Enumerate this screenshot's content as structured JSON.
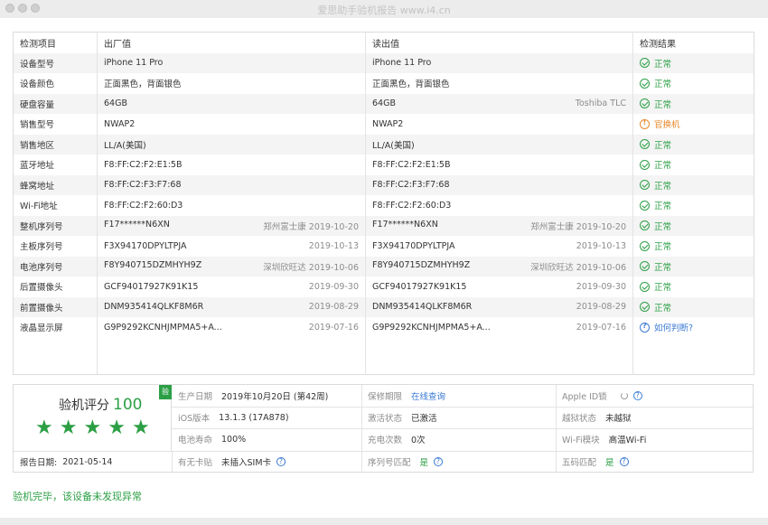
{
  "window": {
    "title": "爱思助手验机报告 www.i4.cn"
  },
  "table": {
    "headers": [
      "检测项目",
      "出厂值",
      "读出值",
      "检测结果"
    ],
    "rows": [
      {
        "item": "设备型号",
        "factory": "iPhone 11 Pro",
        "factory_meta": "",
        "read": "iPhone 11 Pro",
        "read_meta": "",
        "result": "正常",
        "status": "ok"
      },
      {
        "item": "设备颜色",
        "factory": "正面黑色，背面银色",
        "factory_meta": "",
        "read": "正面黑色，背面银色",
        "read_meta": "",
        "result": "正常",
        "status": "ok"
      },
      {
        "item": "硬盘容量",
        "factory": "64GB",
        "factory_meta": "",
        "read": "64GB",
        "read_meta": "Toshiba TLC",
        "result": "正常",
        "status": "ok"
      },
      {
        "item": "销售型号",
        "factory": "NWAP2",
        "factory_meta": "",
        "read": "NWAP2",
        "read_meta": "",
        "result": "官换机",
        "status": "warn"
      },
      {
        "item": "销售地区",
        "factory": "LL/A(美国)",
        "factory_meta": "",
        "read": "LL/A(美国)",
        "read_meta": "",
        "result": "正常",
        "status": "ok"
      },
      {
        "item": "蓝牙地址",
        "factory": "F8:FF:C2:F2:E1:5B",
        "factory_meta": "",
        "read": "F8:FF:C2:F2:E1:5B",
        "read_meta": "",
        "result": "正常",
        "status": "ok"
      },
      {
        "item": "蜂窝地址",
        "factory": "F8:FF:C2:F3:F7:68",
        "factory_meta": "",
        "read": "F8:FF:C2:F3:F7:68",
        "read_meta": "",
        "result": "正常",
        "status": "ok"
      },
      {
        "item": "Wi-Fi地址",
        "factory": "F8:FF:C2:F2:60:D3",
        "factory_meta": "",
        "read": "F8:FF:C2:F2:60:D3",
        "read_meta": "",
        "result": "正常",
        "status": "ok"
      },
      {
        "item": "整机序列号",
        "factory": "F17******N6XN",
        "factory_meta": "郑州富士康 2019-10-20",
        "read": "F17******N6XN",
        "read_meta": "郑州富士康 2019-10-20",
        "result": "正常",
        "status": "ok"
      },
      {
        "item": "主板序列号",
        "factory": "F3X94170DPYLTPJA",
        "factory_meta": "2019-10-13",
        "read": "F3X94170DPYLTPJA",
        "read_meta": "2019-10-13",
        "result": "正常",
        "status": "ok"
      },
      {
        "item": "电池序列号",
        "factory": "F8Y940715DZMHYH9Z",
        "factory_meta": "深圳欣旺达 2019-10-06",
        "read": "F8Y940715DZMHYH9Z",
        "read_meta": "深圳欣旺达 2019-10-06",
        "result": "正常",
        "status": "ok"
      },
      {
        "item": "后置摄像头",
        "factory": "GCF94017927K91K15",
        "factory_meta": "2019-09-30",
        "read": "GCF94017927K91K15",
        "read_meta": "2019-09-30",
        "result": "正常",
        "status": "ok"
      },
      {
        "item": "前置摄像头",
        "factory": "DNM935414QLKF8M6R",
        "factory_meta": "2019-08-29",
        "read": "DNM935414QLKF8M6R",
        "read_meta": "2019-08-29",
        "result": "正常",
        "status": "ok"
      },
      {
        "item": "液晶显示屏",
        "factory": "G9P9292KCNHJMPMA5+A...",
        "factory_meta": "2019-07-16",
        "read": "G9P9292KCNHJMPMA5+A...",
        "read_meta": "2019-07-16",
        "result": "如何判断?",
        "status": "q"
      }
    ]
  },
  "summary": {
    "score_label": "验机评分",
    "score": "100",
    "badge": "验",
    "report_date_label": "报告日期:",
    "report_date": "2021-05-14",
    "production_date_label": "生产日期",
    "production_date": "2019年10月20日 (第42周)",
    "warranty_label": "保修期限",
    "warranty_link": "在线查询",
    "appleid_label": "Apple ID锁",
    "ios_label": "iOS版本",
    "ios_value": "13.1.3 (17A878)",
    "activation_label": "激活状态",
    "activation_value": "已激活",
    "jailbreak_label": "越狱状态",
    "jailbreak_value": "未越狱",
    "battery_label": "电池寿命",
    "battery_value": "100%",
    "charge_label": "充电次数",
    "charge_value": "0次",
    "wifi_label": "Wi-Fi模块",
    "wifi_value": "高温Wi-Fi",
    "sim_label": "有无卡贴",
    "sim_value": "未插入SIM卡",
    "serial_match_label": "序列号匹配",
    "serial_match_value": "是",
    "five_code_label": "五码匹配",
    "five_code_value": "是",
    "help_icon_char": "?"
  },
  "footer": {
    "status": "验机完毕，该设备未发现异常"
  },
  "colors": {
    "accent_green": "#2c9f45",
    "warning_orange": "#e8882b",
    "link_blue": "#3a7ad5"
  }
}
